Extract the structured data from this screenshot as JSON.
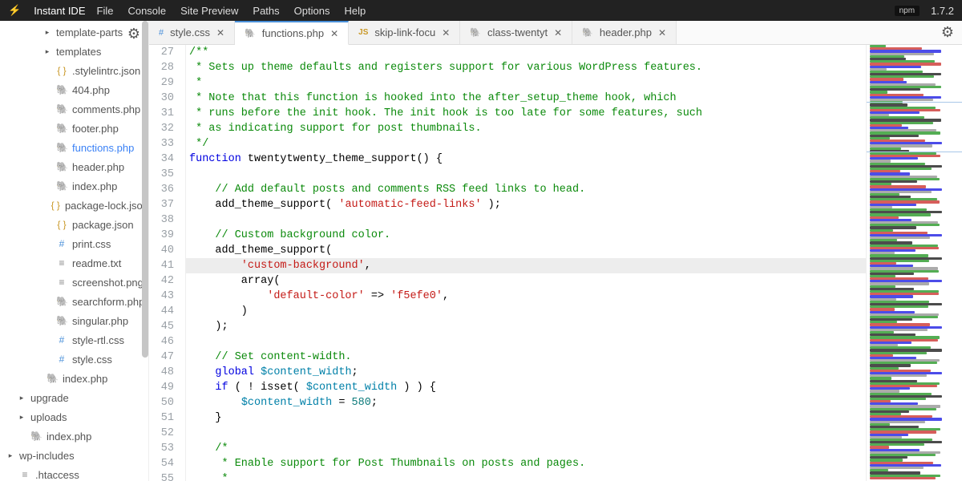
{
  "app": {
    "name": "Instant IDE",
    "version": "1.7.2",
    "npmBadge": "npm"
  },
  "menu": [
    "File",
    "Console",
    "Site Preview",
    "Paths",
    "Options",
    "Help"
  ],
  "tabs": [
    {
      "label": "style.css",
      "type": "css",
      "active": false
    },
    {
      "label": "functions.php",
      "type": "php",
      "active": true
    },
    {
      "label": "skip-link-focu",
      "type": "js",
      "active": false
    },
    {
      "label": "class-twentyt",
      "type": "php",
      "active": false
    },
    {
      "label": "header.php",
      "type": "php",
      "active": false
    }
  ],
  "tree": [
    {
      "label": "template-parts",
      "kind": "folder",
      "level": 3,
      "caret": "right",
      "gear": true
    },
    {
      "label": "templates",
      "kind": "folder",
      "level": 3,
      "caret": "right"
    },
    {
      "label": ".stylelintrc.json",
      "kind": "braces",
      "level": 3
    },
    {
      "label": "404.php",
      "kind": "php",
      "level": 3
    },
    {
      "label": "comments.php",
      "kind": "php",
      "level": 3
    },
    {
      "label": "footer.php",
      "kind": "php",
      "level": 3
    },
    {
      "label": "functions.php",
      "kind": "php",
      "level": 3,
      "active": true
    },
    {
      "label": "header.php",
      "kind": "php",
      "level": 3
    },
    {
      "label": "index.php",
      "kind": "php",
      "level": 3
    },
    {
      "label": "package-lock.json",
      "kind": "braces",
      "level": 3
    },
    {
      "label": "package.json",
      "kind": "braces",
      "level": 3
    },
    {
      "label": "print.css",
      "kind": "hash",
      "level": 3
    },
    {
      "label": "readme.txt",
      "kind": "file",
      "level": 3
    },
    {
      "label": "screenshot.png",
      "kind": "file",
      "level": 3
    },
    {
      "label": "searchform.php",
      "kind": "php",
      "level": 3
    },
    {
      "label": "singular.php",
      "kind": "php",
      "level": 3
    },
    {
      "label": "style-rtl.css",
      "kind": "hash",
      "level": 3
    },
    {
      "label": "style.css",
      "kind": "hash",
      "level": 3
    },
    {
      "label": "index.php",
      "kind": "php",
      "level": 2
    },
    {
      "label": "upgrade",
      "kind": "folder",
      "level": 1,
      "caret": "right"
    },
    {
      "label": "uploads",
      "kind": "folder",
      "level": 1,
      "caret": "right"
    },
    {
      "label": "index.php",
      "kind": "php",
      "level": 1
    },
    {
      "label": "wp-includes",
      "kind": "folder",
      "level": 0,
      "caret": "right"
    },
    {
      "label": ".htaccess",
      "kind": "file",
      "level": 0
    }
  ],
  "code": {
    "startLine": 27,
    "highlight": 41,
    "lines": [
      {
        "n": 27,
        "seg": [
          [
            "doc",
            "/**"
          ]
        ]
      },
      {
        "n": 28,
        "seg": [
          [
            "doc",
            " * Sets up theme defaults and registers support for various WordPress features."
          ]
        ]
      },
      {
        "n": 29,
        "seg": [
          [
            "doc",
            " *"
          ]
        ]
      },
      {
        "n": 30,
        "seg": [
          [
            "doc",
            " * Note that this function is hooked into the after_setup_theme hook, which"
          ]
        ]
      },
      {
        "n": 31,
        "seg": [
          [
            "doc",
            " * runs before the init hook. The init hook is too late for some features, such"
          ]
        ]
      },
      {
        "n": 32,
        "seg": [
          [
            "doc",
            " * as indicating support for post thumbnails."
          ]
        ]
      },
      {
        "n": 33,
        "seg": [
          [
            "doc",
            " */"
          ]
        ]
      },
      {
        "n": 34,
        "seg": [
          [
            "kw",
            "function"
          ],
          [
            "pn",
            " "
          ],
          [
            "fn",
            "twentytwenty_theme_support"
          ],
          [
            "pn",
            "() {"
          ]
        ]
      },
      {
        "n": 35,
        "seg": [
          [
            "pn",
            ""
          ]
        ]
      },
      {
        "n": 36,
        "seg": [
          [
            "pn",
            "    "
          ],
          [
            "cmt",
            "// Add default posts and comments RSS feed links to head."
          ]
        ]
      },
      {
        "n": 37,
        "seg": [
          [
            "pn",
            "    add_theme_support( "
          ],
          [
            "str",
            "'automatic-feed-links'"
          ],
          [
            "pn",
            " );"
          ]
        ]
      },
      {
        "n": 38,
        "seg": [
          [
            "pn",
            ""
          ]
        ]
      },
      {
        "n": 39,
        "seg": [
          [
            "pn",
            "    "
          ],
          [
            "cmt",
            "// Custom background color."
          ]
        ]
      },
      {
        "n": 40,
        "seg": [
          [
            "pn",
            "    add_theme_support("
          ]
        ]
      },
      {
        "n": 41,
        "seg": [
          [
            "pn",
            "        "
          ],
          [
            "str",
            "'custom-background'"
          ],
          [
            "pn",
            ","
          ]
        ]
      },
      {
        "n": 42,
        "seg": [
          [
            "pn",
            "        array("
          ]
        ]
      },
      {
        "n": 43,
        "seg": [
          [
            "pn",
            "            "
          ],
          [
            "str",
            "'default-color'"
          ],
          [
            "pn",
            " => "
          ],
          [
            "str",
            "'f5efe0'"
          ],
          [
            "pn",
            ","
          ]
        ]
      },
      {
        "n": 44,
        "seg": [
          [
            "pn",
            "        )"
          ]
        ]
      },
      {
        "n": 45,
        "seg": [
          [
            "pn",
            "    );"
          ]
        ]
      },
      {
        "n": 46,
        "seg": [
          [
            "pn",
            ""
          ]
        ]
      },
      {
        "n": 47,
        "seg": [
          [
            "pn",
            "    "
          ],
          [
            "cmt",
            "// Set content-width."
          ]
        ]
      },
      {
        "n": 48,
        "seg": [
          [
            "pn",
            "    "
          ],
          [
            "kw",
            "global"
          ],
          [
            "pn",
            " "
          ],
          [
            "var",
            "$content_width"
          ],
          [
            "pn",
            ";"
          ]
        ]
      },
      {
        "n": 49,
        "seg": [
          [
            "pn",
            "    "
          ],
          [
            "kw",
            "if"
          ],
          [
            "pn",
            " ( ! "
          ],
          [
            "fn",
            "isset"
          ],
          [
            "pn",
            "( "
          ],
          [
            "var",
            "$content_width"
          ],
          [
            "pn",
            " ) ) {"
          ]
        ]
      },
      {
        "n": 50,
        "seg": [
          [
            "pn",
            "        "
          ],
          [
            "var",
            "$content_width"
          ],
          [
            "pn",
            " = "
          ],
          [
            "num",
            "580"
          ],
          [
            "pn",
            ";"
          ]
        ]
      },
      {
        "n": 51,
        "seg": [
          [
            "pn",
            "    }"
          ]
        ]
      },
      {
        "n": 52,
        "seg": [
          [
            "pn",
            ""
          ]
        ]
      },
      {
        "n": 53,
        "seg": [
          [
            "pn",
            "    "
          ],
          [
            "doc",
            "/*"
          ]
        ]
      },
      {
        "n": 54,
        "seg": [
          [
            "doc",
            "     * Enable support for Post Thumbnails on posts and pages."
          ]
        ]
      },
      {
        "n": 55,
        "seg": [
          [
            "doc",
            "     *"
          ]
        ]
      }
    ]
  },
  "minimap": {
    "viewportTop": 71,
    "viewportHeight": 62,
    "rows": 170
  }
}
